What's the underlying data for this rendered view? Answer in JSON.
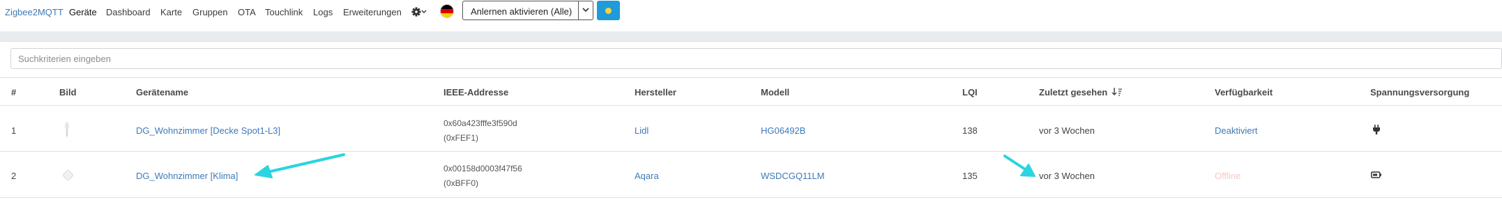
{
  "nav": {
    "brand": "Zigbee2MQTT",
    "links": [
      "Geräte",
      "Dashboard",
      "Karte",
      "Gruppen",
      "OTA",
      "Touchlink",
      "Logs",
      "Erweiterungen"
    ],
    "permit_join_label": "Anlernen aktivieren (Alle)"
  },
  "search": {
    "placeholder": "Suchkriterien eingeben",
    "value": ""
  },
  "table": {
    "headers": [
      "#",
      "Bild",
      "Gerätename",
      "IEEE-Addresse",
      "Hersteller",
      "Modell",
      "LQI",
      "Zuletzt gesehen",
      "Verfügbarkeit",
      "Spannungsversorgung"
    ],
    "rows": [
      {
        "num": "1",
        "name": "DG_Wohnzimmer [Decke Spot1-L3]",
        "ieee": "0x60a423fffe3f590d",
        "nwk": "(0xFEF1)",
        "vendor": "Lidl",
        "model": "HG06492B",
        "lqi": "138",
        "last_seen": "vor 3 Wochen",
        "availability": "Deaktiviert",
        "power_icon": "plug-icon"
      },
      {
        "num": "2",
        "name": "DG_Wohnzimmer [Klima]",
        "ieee": "0x00158d0003f47f56",
        "nwk": "(0xBFF0)",
        "vendor": "Aqara",
        "model": "WSDCGQ11LM",
        "lqi": "135",
        "last_seen": "vor 3 Wochen",
        "availability": "Offline",
        "power_icon": "battery-icon"
      }
    ]
  },
  "colors": {
    "link": "#3d7ab8",
    "accent_button": "#1e9bd8",
    "annotation_arrow": "#2ad4e0",
    "offline": "#f3c9c9"
  }
}
